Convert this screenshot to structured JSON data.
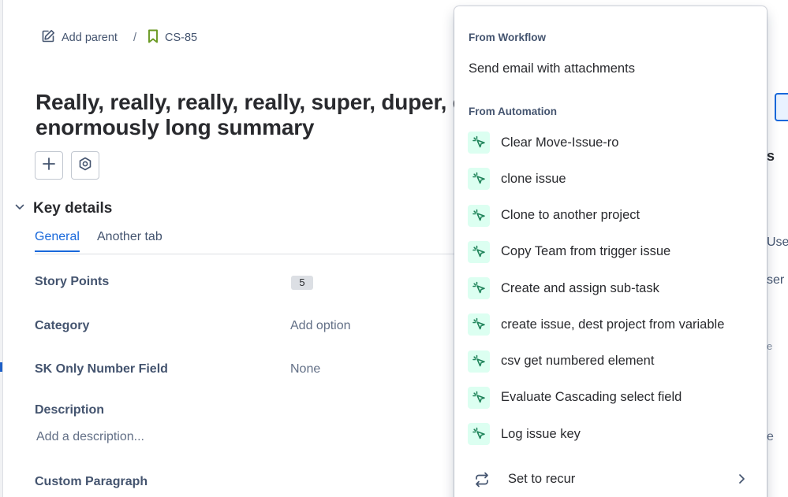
{
  "breadcrumb": {
    "add_parent": "Add parent",
    "separator": "/",
    "issue_key": "CS-85"
  },
  "issue": {
    "summary_line1": "Really, really, really, really, super, duper, e",
    "summary_line2": "enormously long summary"
  },
  "key_details": {
    "title": "Key details",
    "tabs": [
      {
        "label": "General",
        "active": true
      },
      {
        "label": "Another tab",
        "active": false
      }
    ],
    "fields": [
      {
        "label": "Story Points",
        "value": "5"
      },
      {
        "label": "Category",
        "value": "Add option"
      },
      {
        "label": "SK Only Number Field",
        "value": "None"
      }
    ],
    "description_label": "Description",
    "description_placeholder": "Add a description...",
    "custom_paragraph_label": "Custom Paragraph"
  },
  "background_fragments": [
    "s",
    "Use",
    "ser",
    "e",
    "e"
  ],
  "menu": {
    "workflow_group": "From Workflow",
    "workflow_items": [
      "Send email with attachments"
    ],
    "automation_group": "From Automation",
    "automation_items": [
      "Clear Move-Issue-ro",
      "clone issue",
      "Clone to another project",
      "Copy Team from trigger issue",
      "Create and assign sub-task",
      "create issue, dest project from variable",
      "csv get numbered element",
      "Evaluate Cascading select field",
      "Log issue key"
    ],
    "recur_label": "Set to recur"
  },
  "colors": {
    "accent": "#1868db",
    "automation_icon_bg": "#dcfff1",
    "automation_icon_fg": "#1f845a",
    "bookmark_green": "#6a9a23"
  },
  "icons": {
    "add_parent": "edit-icon",
    "issue_type": "bookmark-icon",
    "add": "plus-icon",
    "apps": "hexagon-gear-icon",
    "collapse": "chevron-down-icon",
    "automation": "cursor-click-icon",
    "recur": "recur-icon",
    "submenu": "chevron-right-icon"
  }
}
